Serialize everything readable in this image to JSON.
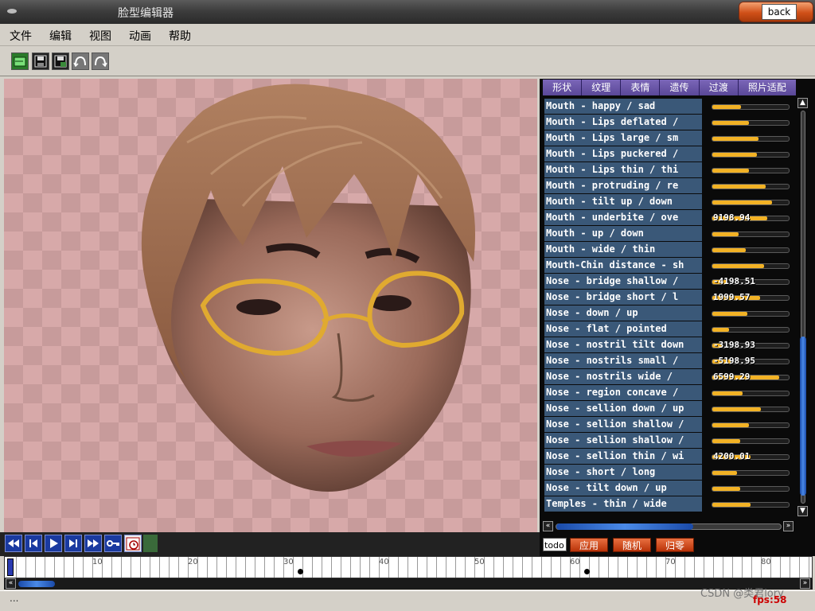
{
  "window": {
    "title": "脸型编辑器",
    "back_label": "back"
  },
  "menu": [
    "文件",
    "编辑",
    "视图",
    "动画",
    "帮助"
  ],
  "toolbar_icons": [
    "open-icon",
    "save-icon",
    "save-as-icon",
    "undo-icon",
    "redo-icon"
  ],
  "panel": {
    "tabs": [
      "形状",
      "纹理",
      "表情",
      "遗传",
      "过渡",
      "照片适配"
    ],
    "parameters": [
      {
        "label": "Mouth - happy / sad",
        "level": 0.38
      },
      {
        "label": "Mouth - Lips deflated / ",
        "level": 0.48
      },
      {
        "label": "Mouth - Lips large / sm",
        "level": 0.6
      },
      {
        "label": "Mouth - Lips puckered /",
        "level": 0.58
      },
      {
        "label": "Mouth - Lips thin / thi",
        "level": 0.48
      },
      {
        "label": "Mouth - protruding / re",
        "level": 0.7
      },
      {
        "label": "Mouth - tilt up / down",
        "level": 0.78
      },
      {
        "label": "Mouth - underbite / ove",
        "value": "9198.94",
        "level": 0.72
      },
      {
        "label": "Mouth - up / down",
        "level": 0.34
      },
      {
        "label": "Mouth - wide / thin",
        "level": 0.44
      },
      {
        "label": "Mouth-Chin distance - sh",
        "level": 0.68
      },
      {
        "label": "Nose - bridge shallow /",
        "value": "-4198.51",
        "level": 0.2
      },
      {
        "label": "Nose - bridge short / l",
        "value": "1999.57",
        "level": 0.62
      },
      {
        "label": "Nose - down / up",
        "level": 0.46
      },
      {
        "label": "Nose - flat / pointed",
        "level": 0.22
      },
      {
        "label": "Nose - nostril tilt down",
        "value": "-3198.93",
        "level": 0.14
      },
      {
        "label": "Nose - nostrils small /",
        "value": "-5198.95",
        "level": 0.24
      },
      {
        "label": "Nose - nostrils wide / ",
        "value": "6599.29",
        "level": 0.88
      },
      {
        "label": "Nose - region concave /",
        "level": 0.4
      },
      {
        "label": "Nose - sellion down / up",
        "level": 0.64
      },
      {
        "label": "Nose - sellion shallow /",
        "level": 0.48
      },
      {
        "label": "Nose - sellion shallow /",
        "level": 0.36
      },
      {
        "label": "Nose - sellion thin / wi",
        "value": "4200.01",
        "level": 0.5
      },
      {
        "label": "Nose - short / long",
        "level": 0.32
      },
      {
        "label": "Nose - tilt down / up",
        "level": 0.36
      },
      {
        "label": "Temples - thin / wide",
        "level": 0.5
      }
    ],
    "todo_label": "todo",
    "actions": [
      "应用",
      "随机",
      "归零"
    ]
  },
  "timeline": {
    "labels": [
      "0",
      "10",
      "20",
      "30",
      "40",
      "50",
      "60",
      "70",
      "80"
    ],
    "keyframes": [
      30,
      60
    ]
  },
  "status": {
    "dots": "...",
    "fps": "fps:58",
    "watermark": "CSDN @类君lory"
  },
  "colors": {
    "slider_fill": "#f2b225",
    "label_bg": "#3a5878",
    "tab_bg": "#6b56a8",
    "action_button": "#d05018"
  }
}
